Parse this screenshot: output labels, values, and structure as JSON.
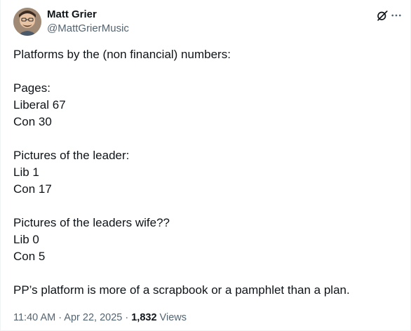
{
  "author": {
    "display_name": "Matt Grier",
    "handle": "@MattGrierMusic"
  },
  "header_icons": {
    "grok": "grok-icon",
    "more": "more-options-icon"
  },
  "tweet": {
    "lines": [
      "Platforms by the (non financial) numbers:",
      "",
      "Pages:",
      "Liberal 67",
      "Con 30",
      "",
      "Pictures of the leader:",
      "Lib 1",
      "Con 17",
      "",
      "Pictures of the leaders wife??",
      "Lib 0",
      "Con 5",
      "",
      "PP’s platform is more of a scrapbook or a pamphlet than a plan."
    ]
  },
  "meta": {
    "time": "11:40 AM",
    "separator1": " · ",
    "date": "Apr 22, 2025",
    "separator2": " · ",
    "views_count": "1,832",
    "views_label": " Views"
  }
}
